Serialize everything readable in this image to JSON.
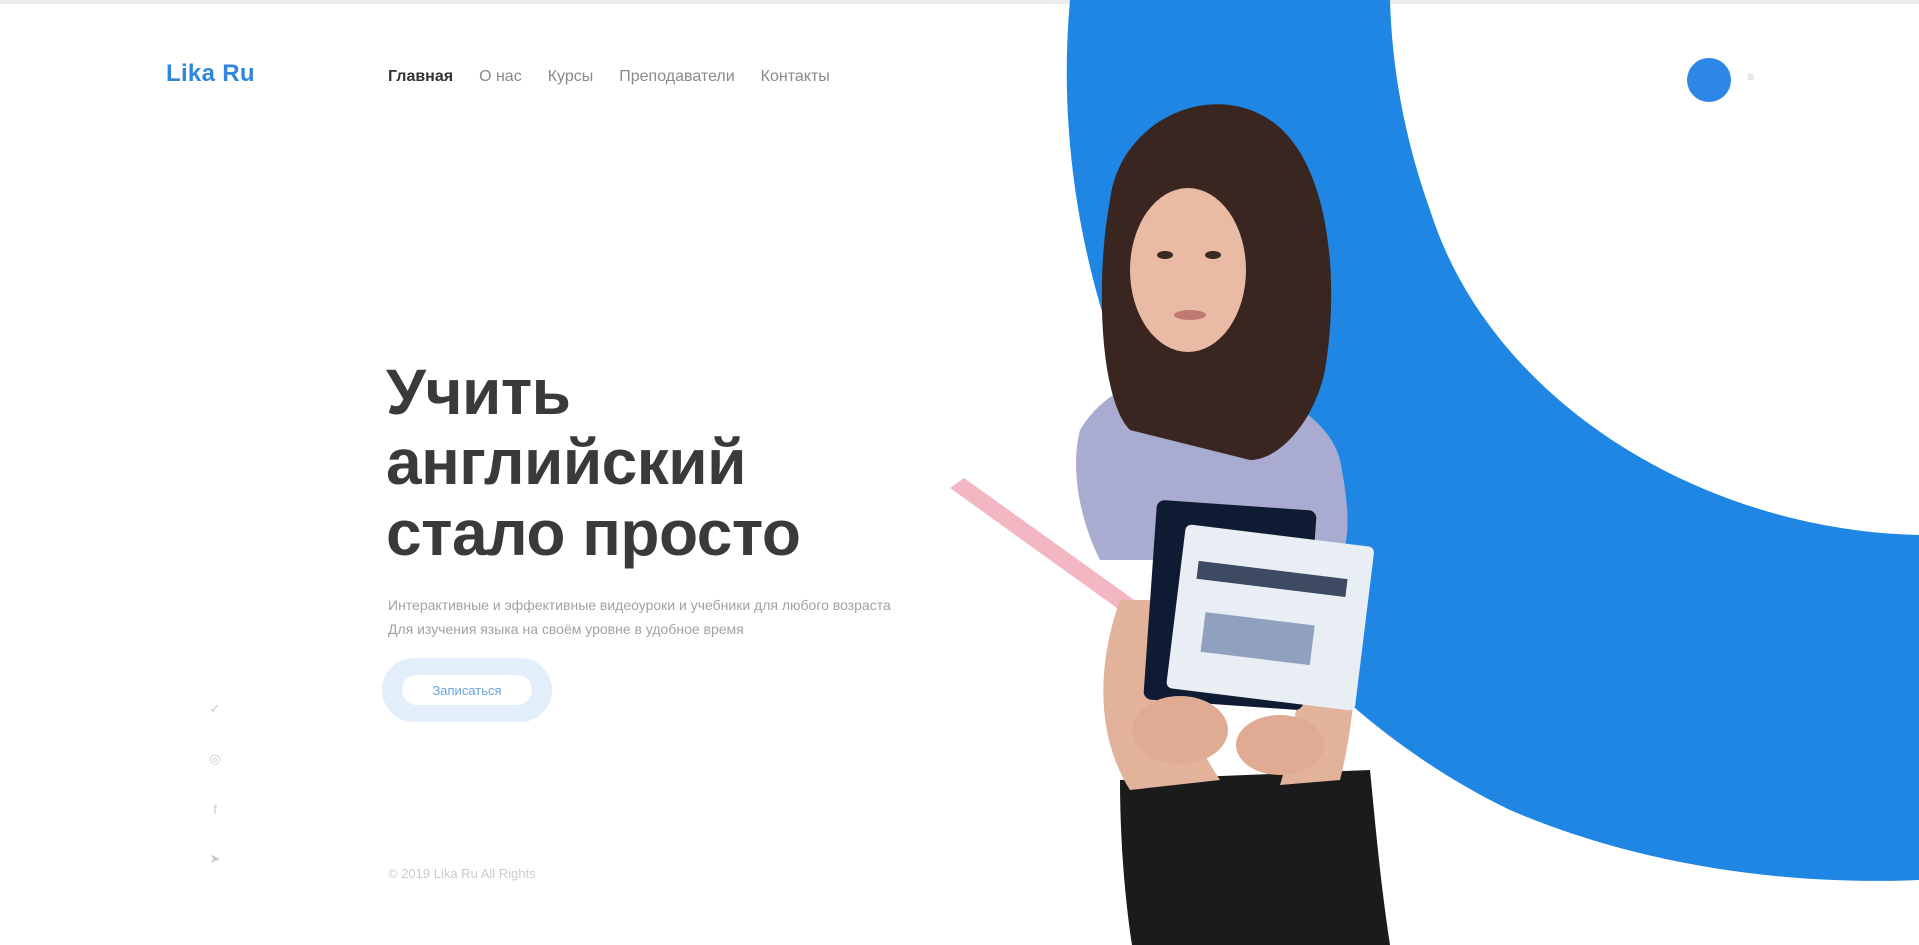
{
  "header": {
    "logo": "Lika Ru",
    "nav": [
      "Главная",
      "О нас",
      "Курсы",
      "Преподаватели",
      "Контакты"
    ],
    "active_index": 0,
    "mini_label": "≡"
  },
  "hero": {
    "title_lines": [
      "Учить",
      "английский",
      "стало просто"
    ],
    "subtitle_lines": [
      "Интерактивные и эффективные видеоуроки и учебники для любого возраста",
      "Для изучения языка на своём уровне в удобное время"
    ],
    "cta_label": "Записаться"
  },
  "social": {
    "items": [
      {
        "icon": "vk-icon",
        "glyph": "✓"
      },
      {
        "icon": "instagram-icon",
        "glyph": "◎"
      },
      {
        "icon": "facebook-icon",
        "glyph": "f"
      },
      {
        "icon": "telegram-icon",
        "glyph": "➤"
      }
    ]
  },
  "footer": {
    "note": "© 2019 Lika Ru All Rights"
  },
  "colors": {
    "accent": "#1F87E3",
    "logo": "#2f86de",
    "cta_bg": "#e2eefa",
    "title": "#3a3a3a"
  }
}
